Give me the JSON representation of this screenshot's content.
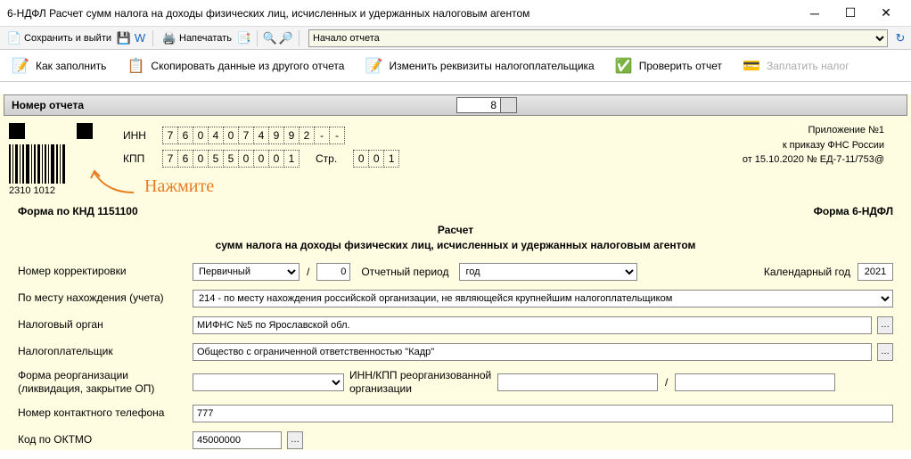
{
  "window": {
    "title": "6-НДФЛ Расчет сумм налога на доходы физических лиц, исчисленных и удержанных налоговым агентом"
  },
  "toolbar1": {
    "save_exit": "Сохранить и выйти",
    "print": "Напечатать",
    "period_selector": "Начало отчета"
  },
  "toolbar2": {
    "how_fill": "Как заполнить",
    "copy_data": "Скопировать данные из другого отчета",
    "edit_requisites": "Изменить реквизиты налогоплательщика",
    "check_report": "Проверить отчет",
    "pay_tax": "Заплатить налог"
  },
  "annotation": "Нажмите",
  "report": {
    "num_label": "Номер отчета",
    "num_value": "8",
    "inn_label": "ИНН",
    "inn": [
      "7",
      "6",
      "0",
      "4",
      "0",
      "7",
      "4",
      "9",
      "9",
      "2",
      "-",
      "-"
    ],
    "kpp_label": "КПП",
    "kpp": [
      "7",
      "6",
      "0",
      "5",
      "5",
      "0",
      "0",
      "0",
      "1"
    ],
    "stranica_label": "Стр.",
    "stranica": [
      "0",
      "0",
      "1"
    ],
    "barcode_num": "2310 1012",
    "appendix": {
      "line1": "Приложение №1",
      "line2": "к приказу ФНС России",
      "line3": "от 15.10.2020 № ЕД-7-11/753@"
    },
    "form_knd": "Форма по КНД 1151100",
    "form_name": "Форма 6-НДФЛ",
    "calc_title1": "Расчет",
    "calc_title2": "сумм налога на доходы физических лиц, исчисленных и удержанных налоговым агентом"
  },
  "fields": {
    "correction_label": "Номер корректировки",
    "correction_type": "Первичный",
    "correction_num": "0",
    "period_label": "Отчетный период",
    "period_value": "год",
    "year_label": "Календарный год",
    "year_value": "2021",
    "place_label": "По месту нахождения (учета)",
    "place_value": "214 - по месту нахождения российской организации, не являющейся крупнейшим налогоплательщиком",
    "tax_authority_label": "Налоговый орган",
    "tax_authority_value": "МИФНС №5 по Ярославской обл.",
    "taxpayer_label": "Налогоплательщик",
    "taxpayer_value": "Общество с ограниченной ответственностью \"Кадр\"",
    "reorg_form_label": "Форма реорганизации (ликвидация, закрытие ОП)",
    "reorg_inn_kpp_label": "ИНН/КПП реорганизованной организации",
    "phone_label": "Номер контактного телефона",
    "phone_value": "777",
    "oktmo_label": "Код по ОКТМО",
    "oktmo_value": "45000000"
  }
}
